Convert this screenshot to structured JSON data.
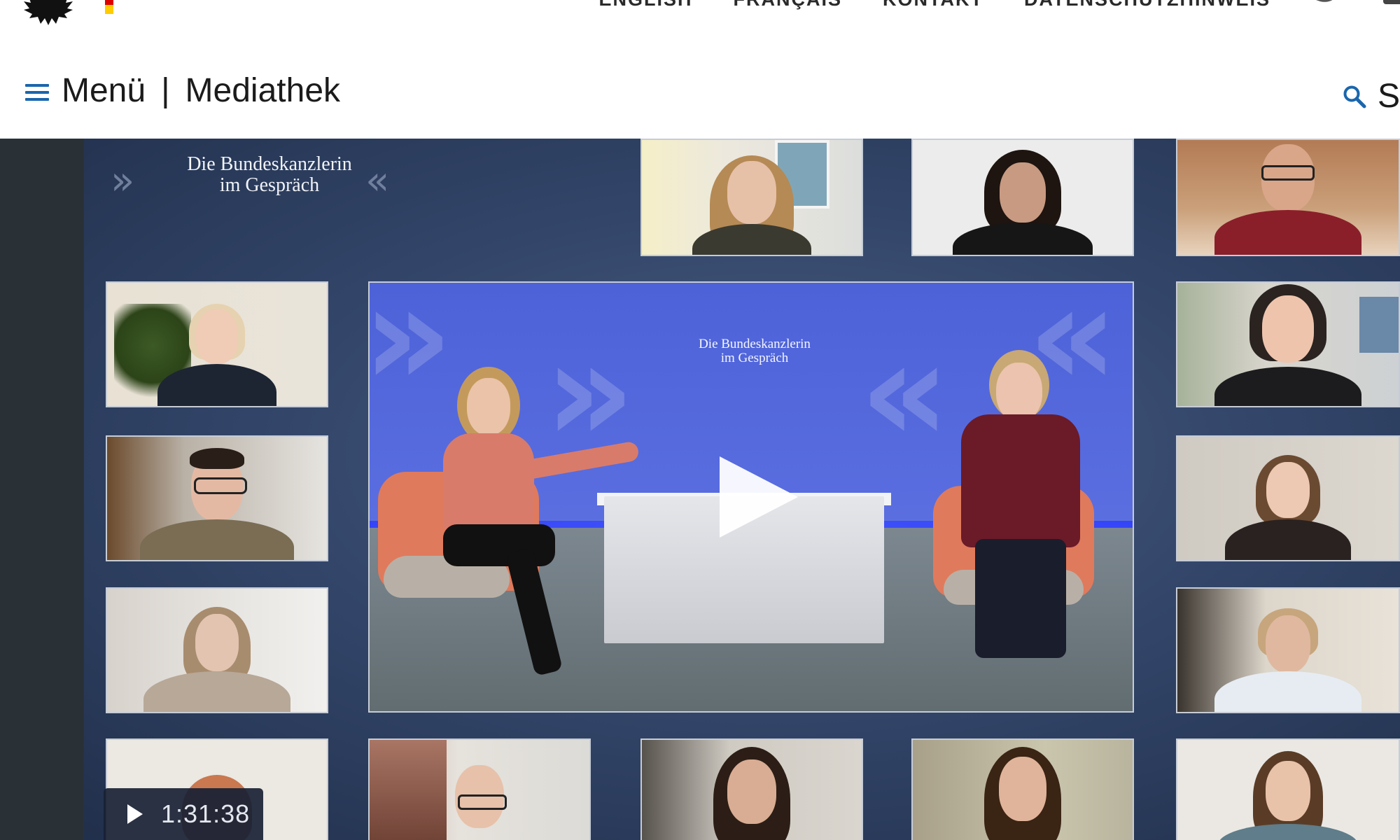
{
  "meta_nav": {
    "items": [
      "ENGLISH",
      "FRANÇAIS",
      "KONTAKT",
      "DATENSCHUTZHINWEIS"
    ]
  },
  "header": {
    "menu_label": "Menü",
    "separator": "|",
    "section_title": "Mediathek",
    "search_label_partial": "Su"
  },
  "stage": {
    "brand_line1": "Die Bundeskanzlerin",
    "brand_line2": "im Gespräch",
    "main_logo_line1": "Die Bundeskanzlerin",
    "main_logo_line2": "im Gespräch",
    "duration": "1:31:38"
  },
  "colors": {
    "accent_blue": "#1a66ad",
    "flag_black": "#000000",
    "flag_red": "#dd0000",
    "flag_gold": "#ffcc00",
    "stage_dark": "#2a3136"
  }
}
